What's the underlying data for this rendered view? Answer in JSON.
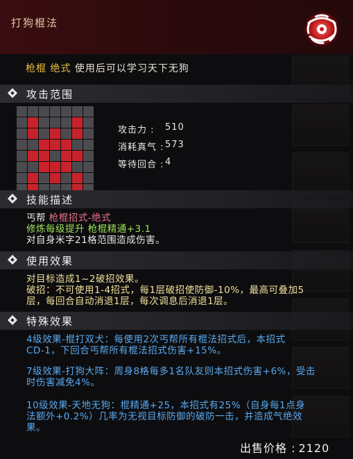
{
  "title": "打狗棍法",
  "skill_icon": "red-swirl-skill-icon",
  "description": {
    "prefix": "枪棍 绝式",
    "text": "使用后可以学习天下无狗"
  },
  "sections": {
    "range": "攻击范围",
    "skill_desc": "技能描述",
    "use_effect": "使用效果",
    "special_effect": "特殊效果"
  },
  "range_grid": [
    [
      0,
      0,
      0,
      0,
      0,
      0,
      0
    ],
    [
      0,
      1,
      0,
      0,
      0,
      1,
      0
    ],
    [
      0,
      1,
      0,
      1,
      0,
      1,
      0
    ],
    [
      0,
      0,
      1,
      1,
      1,
      0,
      0
    ],
    [
      0,
      1,
      1,
      0,
      1,
      1,
      0
    ],
    [
      0,
      0,
      1,
      1,
      1,
      0,
      0
    ],
    [
      0,
      1,
      0,
      1,
      0,
      1,
      0
    ],
    [
      0,
      1,
      0,
      0,
      0,
      1,
      0
    ],
    [
      0,
      0,
      0,
      0,
      0,
      0,
      0
    ]
  ],
  "stats": [
    {
      "label": "攻击力 :",
      "value": "510"
    },
    {
      "label": "消耗真气 :",
      "value": "573"
    },
    {
      "label": "等待回合 :",
      "value": "4"
    }
  ],
  "skill_desc_lines": {
    "sect": "丐帮",
    "type": "枪棍招式-绝式",
    "training": "修炼每级提升 枪棍精通+3.1",
    "effect": "对自身米字21格范围造成伤害。"
  },
  "use_effect_lines": {
    "line1": "对目标造成1~2破招效果。",
    "line2": "破招：不可使用1-4招式，每1层破招使防御-10%，最高可叠加5",
    "line3": "层，每回合自动消退1层，每次调息后消退1层。"
  },
  "special_lines": {
    "l1": "4级效果-棍打双犬：每使用2次丐帮所有棍法招式后，本招式",
    "l2": "CD-1，下回合丐帮所有棍法招式伤害+15%。",
    "l3": "7级效果-打狗大阵：周身8格每多1名队友则本招式伤害+6%，受击",
    "l4": "时伤害减免4%。",
    "l5": "10级效果-天地无狗：棍精通+25，本招式有25%（自身每1点身",
    "l6": "法额外+0.2%）几率为无视目标防御的破防一击，并造成气绝效",
    "l7": "果。"
  },
  "price": {
    "label": "出售价格 :",
    "value": "2120"
  },
  "colors": {
    "title_bg": "#3a0d10",
    "red_cell": "#c8232c",
    "gold": "#f0c040",
    "blue": "#5aa9f0",
    "green": "#9ee05a"
  }
}
